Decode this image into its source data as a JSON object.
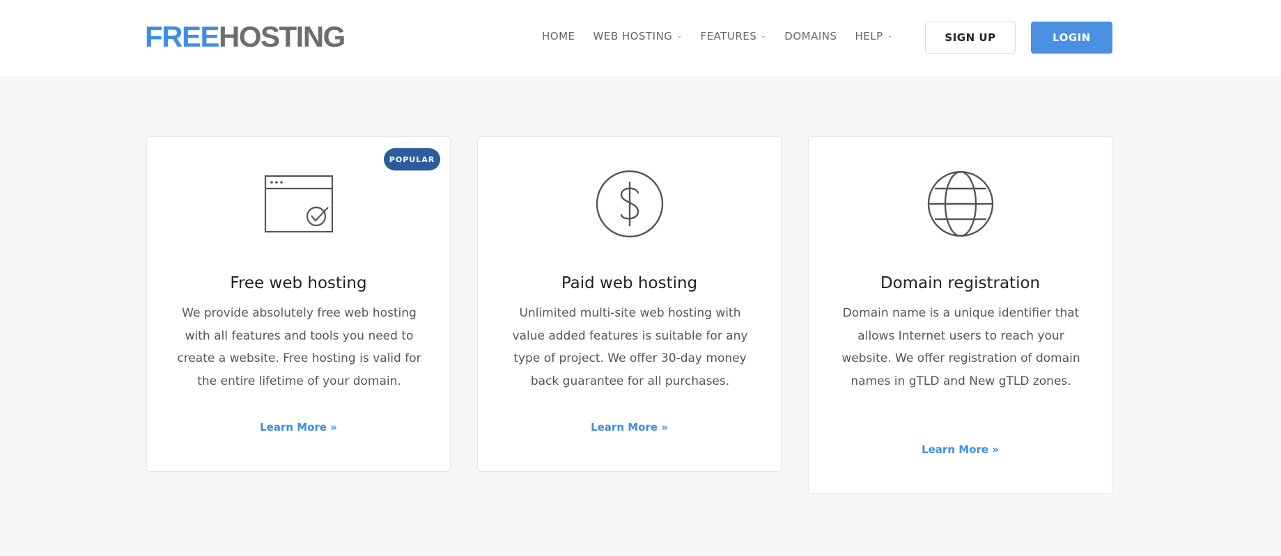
{
  "logo": {
    "part1": "FREE",
    "part2": "HOSTING"
  },
  "nav": [
    {
      "label": "HOME",
      "dropdown": false
    },
    {
      "label": "WEB HOSTING",
      "dropdown": true
    },
    {
      "label": "FEATURES",
      "dropdown": true
    },
    {
      "label": "DOMAINS",
      "dropdown": false
    },
    {
      "label": "HELP",
      "dropdown": true
    }
  ],
  "buttons": {
    "signup": "SIGN UP",
    "login": "LOGIN"
  },
  "cards": [
    {
      "icon": "browser-check-icon",
      "badge": "POPULAR",
      "title": "Free web hosting",
      "text": "We provide absolutely free web hosting with all features and tools you need to create a website. Free hosting is valid for the entire lifetime of your domain.",
      "link": "Learn More »"
    },
    {
      "icon": "dollar-icon",
      "title": "Paid web hosting",
      "text": "Unlimited multi-site web hosting with value added features is suitable for any type of project. We offer 30-day money back guarantee for all purchases.",
      "link": "Learn More »"
    },
    {
      "icon": "globe-icon",
      "title": "Domain registration",
      "text": "Domain name is a unique identifier that allows Internet users to reach your website. We offer registration of domain names in gTLD and New gTLD zones.",
      "link": "Learn More »"
    }
  ],
  "colors": {
    "brand_blue": "#3d8ee8",
    "login_blue": "#4a90e2",
    "badge_blue": "#2b5d9e",
    "logo_gray": "#6d6d6d"
  }
}
